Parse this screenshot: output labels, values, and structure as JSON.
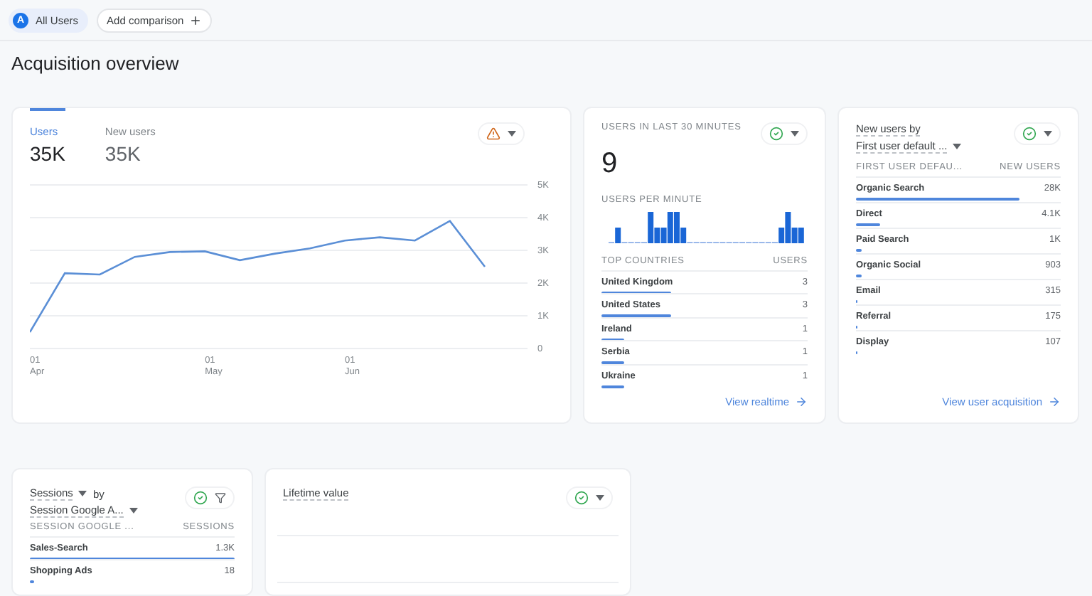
{
  "top_bar": {
    "chips": [
      {
        "badge": "A",
        "label": "All Users"
      }
    ],
    "add_comparison": "Add comparison"
  },
  "page_title": "Acquisition overview",
  "users_card": {
    "tabs": [
      {
        "label": "Users",
        "value": "35K",
        "selected": true
      },
      {
        "label": "New users",
        "value": "35K",
        "selected": false
      }
    ],
    "chart_data": {
      "type": "line",
      "grid": true,
      "categories": [
        "01 Apr",
        null,
        null,
        null,
        null,
        "01 May",
        null,
        null,
        null,
        "01 Jun",
        null,
        null,
        null,
        null
      ],
      "series": [
        {
          "color": "#5b8fd6",
          "values": [
            500,
            2300,
            2260,
            2800,
            2950,
            2970,
            2700,
            2900,
            3060,
            3300,
            3400,
            3300,
            3900,
            2500
          ]
        }
      ],
      "ylim": [
        0,
        5000
      ],
      "yticks": [
        {
          "value": 0,
          "label": "0"
        },
        {
          "value": 1000,
          "label": "1K"
        },
        {
          "value": 2000,
          "label": "2K"
        },
        {
          "value": 3000,
          "label": "3K"
        },
        {
          "value": 4000,
          "label": "4K"
        },
        {
          "value": 5000,
          "label": "5K"
        }
      ]
    }
  },
  "realtime_card": {
    "title": "USERS IN LAST 30 MINUTES",
    "value": "9",
    "subtitle": "USERS PER MINUTE",
    "columns": [
      "TOP COUNTRIES",
      "USERS"
    ],
    "rows": [
      {
        "name": "United Kingdom",
        "value": "3",
        "level": 0.34
      },
      {
        "name": "United States",
        "value": "3",
        "level": 0.34
      },
      {
        "name": "Ireland",
        "value": "1",
        "level": 0.11
      },
      {
        "name": "Serbia",
        "value": "1",
        "level": 0.11
      },
      {
        "name": "Ukraine",
        "value": "1",
        "level": 0.11
      }
    ],
    "link": "View realtime"
  },
  "acquisition_card": {
    "metric": "New users by",
    "metric_dropdown": false,
    "dimension": "First user default ...",
    "columns": [
      "FIRST USER DEFAU...",
      "NEW USERS"
    ],
    "rows": [
      {
        "name": "Organic Search",
        "value": "28K",
        "level": 0.8
      },
      {
        "name": "Direct",
        "value": "4.1K",
        "level": 0.12
      },
      {
        "name": "Paid Search",
        "value": "1K",
        "level": 0.03
      },
      {
        "name": "Organic Social",
        "value": "903",
        "level": 0.03
      },
      {
        "name": "Email",
        "value": "315",
        "level": 0.01
      },
      {
        "name": "Referral",
        "value": "175",
        "level": 0.006
      },
      {
        "name": "Display",
        "value": "107",
        "level": 0.004
      }
    ],
    "link": "View user acquisition"
  },
  "sessions_card": {
    "metric": "Sessions",
    "metric_dropdown": true,
    "connector": "by",
    "dimension": "Session Google A...",
    "columns": [
      "SESSION GOOGLE ...",
      "SESSIONS"
    ],
    "rows": [
      {
        "name": "Sales-Search",
        "value": "1.3K",
        "level": 1
      },
      {
        "name": "Shopping Ads",
        "value": "18",
        "level": 0.02
      }
    ]
  },
  "lifetime_card": {
    "title": "Lifetime value"
  }
}
